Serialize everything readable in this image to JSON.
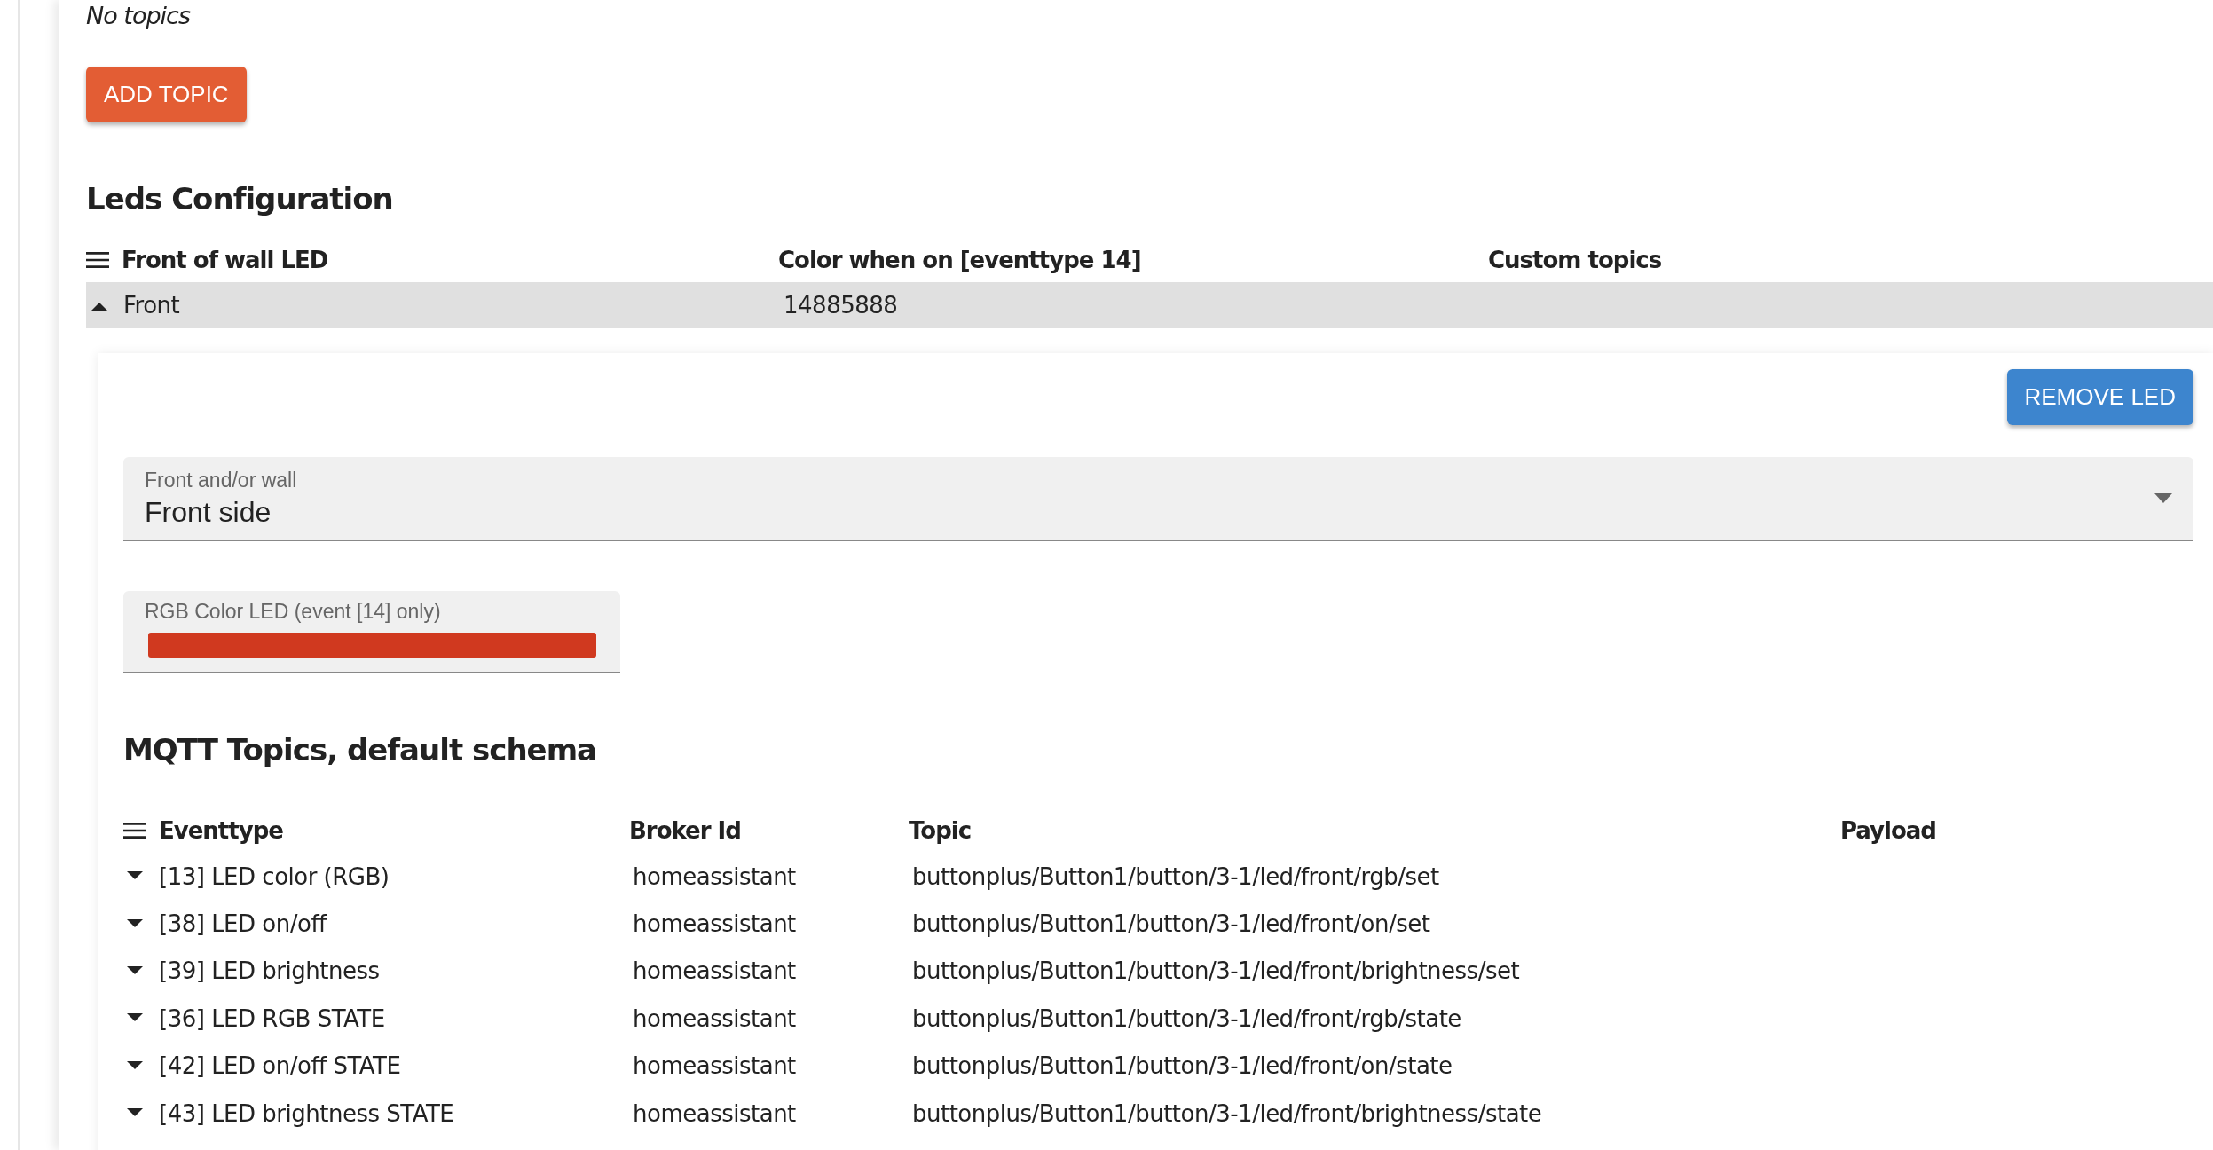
{
  "topics_section": {
    "empty_text": "No topics",
    "add_button": "ADD TOPIC"
  },
  "leds": {
    "title": "Leds Configuration",
    "columns": [
      "Front of wall LED",
      "Color when on [eventtype 14]",
      "Custom topics"
    ],
    "rows": [
      {
        "cells": [
          "Front",
          "14885888",
          ""
        ],
        "expanded": true
      }
    ],
    "detail": {
      "remove_button": "REMOVE LED",
      "select": {
        "label": "Front and/or wall",
        "value": "Front side"
      },
      "color_field": {
        "label": "RGB Color LED (event [14] only)",
        "color": "#d0391f"
      },
      "mqtt": {
        "title": "MQTT Topics, default schema",
        "columns": [
          "Eventtype",
          "Broker Id",
          "Topic",
          "Payload"
        ],
        "rows": [
          {
            "cells": [
              "[13] LED color (RGB)",
              "homeassistant",
              "buttonplus/Button1/button/3-1/led/front/rgb/set"
            ],
            "expanded": false
          },
          {
            "cells": [
              "[38] LED on/off",
              "homeassistant",
              "buttonplus/Button1/button/3-1/led/front/on/set"
            ],
            "expanded": false
          },
          {
            "cells": [
              "[39] LED brightness",
              "homeassistant",
              "buttonplus/Button1/button/3-1/led/front/brightness/set"
            ],
            "expanded": false
          },
          {
            "cells": [
              "[36] LED RGB STATE",
              "homeassistant",
              "buttonplus/Button1/button/3-1/led/front/rgb/state"
            ],
            "expanded": false
          },
          {
            "cells": [
              "[42] LED on/off STATE",
              "homeassistant",
              "buttonplus/Button1/button/3-1/led/front/on/state"
            ],
            "expanded": false
          },
          {
            "cells": [
              "[43] LED brightness STATE",
              "homeassistant",
              "buttonplus/Button1/button/3-1/led/front/brightness/state"
            ],
            "expanded": false
          }
        ]
      }
    }
  }
}
